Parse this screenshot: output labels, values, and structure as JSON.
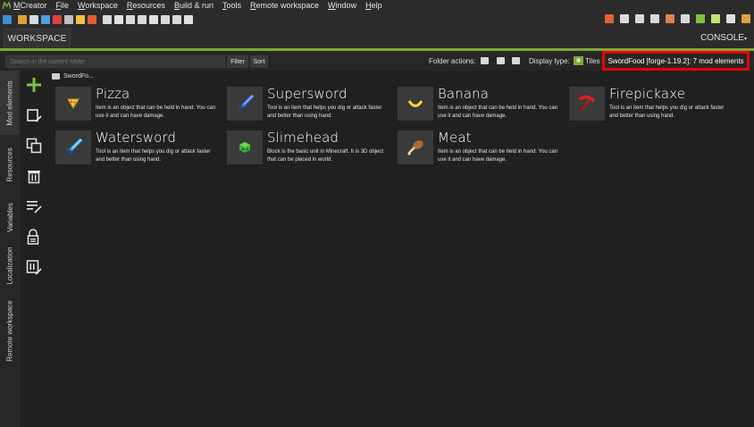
{
  "menubar": {
    "items": [
      "MCreator",
      "File",
      "Workspace",
      "Resources",
      "Build & run",
      "Tools",
      "Remote workspace",
      "Window",
      "Help"
    ]
  },
  "tabs": {
    "workspace": "WORKSPACE",
    "console": "CONSOLE"
  },
  "search": {
    "placeholder": "Search in the current folder",
    "filter_label": "Filter",
    "sort_label": "Sort"
  },
  "folder_actions_label": "Folder actions:",
  "display_type_label": "Display type:",
  "display_type_value": "Tiles",
  "workspace_info": "SwordFood [forge-1.19.2]: 7 mod elements",
  "breadcrumb": "SwordFo...",
  "side_tabs": [
    "Mod elements",
    "Resources",
    "Variables",
    "Localization",
    "Remote workspace"
  ],
  "colors": {
    "accent": "#7fa53a",
    "highlight_box": "#ea0000",
    "background": "#202020"
  },
  "elements": [
    {
      "name": "Pizza",
      "desc": "Item is an object that can be held in hand. You can use it and can have damage.",
      "icon": "pizza-icon"
    },
    {
      "name": "Supersword",
      "desc": "Tool is an item that helps you dig or attack faster and better than using hand.",
      "icon": "sword-blue-icon"
    },
    {
      "name": "Banana",
      "desc": "Item is an object that can be held in hand. You can use it and can have damage.",
      "icon": "banana-icon"
    },
    {
      "name": "Firepickaxe",
      "desc": "Tool is an item that helps you dig or attack faster and better than using hand.",
      "icon": "pickaxe-red-icon"
    },
    {
      "name": "Watersword",
      "desc": "Tool is an item that helps you dig or attack faster and better than using hand.",
      "icon": "sword-water-icon"
    },
    {
      "name": "Slimehead",
      "desc": "Block is the basic unit in Minecraft. It is 3D object that can be placed in world.",
      "icon": "slime-block-icon"
    },
    {
      "name": "Meat",
      "desc": "Item is an object that can be held in hand. You can use it and can have damage.",
      "icon": "meat-icon"
    }
  ]
}
